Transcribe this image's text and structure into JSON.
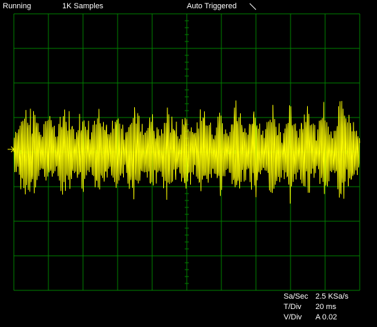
{
  "status_bar": {
    "run_state": "Running",
    "sample_count": "1K Samples",
    "trigger_mode": "Auto Triggered",
    "trigger_slope_icon": "falling-slope-icon"
  },
  "display": {
    "grid_color": "#008000",
    "trace_color": "#ffff00",
    "background": "#000000",
    "divisions_x": 10,
    "divisions_y": 8,
    "trigger_marker_icon": "trigger-level-arrow-icon"
  },
  "readouts": [
    {
      "label": "Sa/Sec",
      "value": "2.5 KSa/s"
    },
    {
      "label": "T/Div",
      "value": "20 ms"
    },
    {
      "label": "V/Div",
      "value": "A 0.02"
    }
  ],
  "chart_data": {
    "type": "line",
    "title": "",
    "xlabel": "",
    "ylabel": "",
    "x_unit": "ms",
    "y_unit": "V",
    "xlim": [
      0,
      200
    ],
    "ylim": [
      -0.08,
      0.08
    ],
    "grid": true,
    "series": [
      {
        "x": [
          0,
          10,
          20,
          30,
          40,
          50,
          60,
          70,
          80,
          90,
          100,
          110,
          120,
          130,
          140,
          150,
          160,
          170,
          180,
          190,
          200
        ],
        "values": [
          0.0,
          0.025,
          -0.02,
          0.026,
          -0.022,
          0.024,
          -0.021,
          0.027,
          -0.02,
          0.025,
          -0.022,
          0.024,
          -0.02,
          0.026,
          -0.023,
          0.025,
          -0.021,
          0.024,
          -0.022,
          0.025,
          0.0
        ]
      }
    ]
  }
}
